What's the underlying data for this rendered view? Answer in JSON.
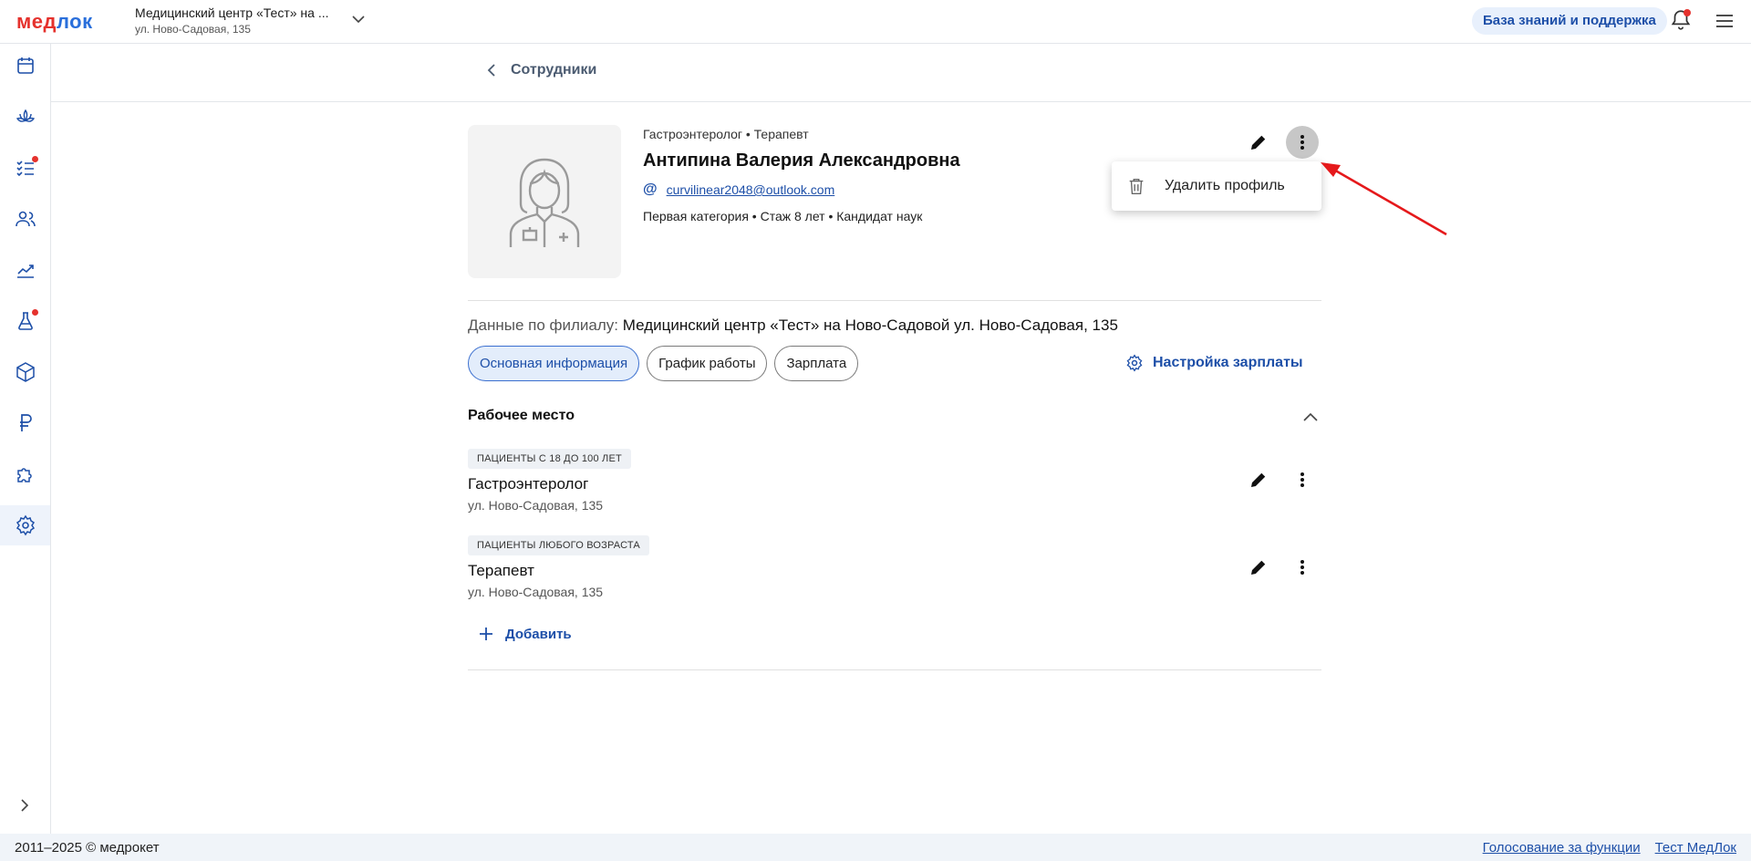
{
  "header": {
    "logo_part1": "мед",
    "logo_part2": "лок",
    "clinic_name": "Медицинский центр «Тест» на ...",
    "clinic_address": "ул. Ново-Садовая, 135",
    "kb_button": "База знаний и поддержка"
  },
  "sidebar": {
    "items": [
      {
        "icon": "calendar-icon"
      },
      {
        "icon": "lotus-icon"
      },
      {
        "icon": "checklist-icon"
      },
      {
        "icon": "users-icon"
      },
      {
        "icon": "chart-icon"
      },
      {
        "icon": "flask-icon"
      },
      {
        "icon": "box-icon"
      },
      {
        "icon": "ruble-icon"
      },
      {
        "icon": "puzzle-icon"
      },
      {
        "icon": "gear-icon"
      }
    ]
  },
  "breadcrumb": {
    "back_label": "Сотрудники"
  },
  "profile": {
    "specialties": "Гастроэнтеролог • Терапевт",
    "full_name": "Антипина Валерия Александровна",
    "email": "curvilinear2048@outlook.com",
    "meta": "Первая категория • Стаж 8 лет • Кандидат наук"
  },
  "context_menu": {
    "delete_label": "Удалить профиль"
  },
  "branch": {
    "label": "Данные по филиалу:",
    "value": "Медицинский центр «Тест» на Ново-Садовой ул. Ново-Садовая, 135"
  },
  "tabs": [
    {
      "label": "Основная информация",
      "active": true
    },
    {
      "label": "График работы",
      "active": false
    },
    {
      "label": "Зарплата",
      "active": false
    }
  ],
  "salary_settings_label": "Настройка зарплаты",
  "workplace": {
    "title": "Рабочее место",
    "items": [
      {
        "tag": "ПАЦИЕНТЫ С 18 ДО 100 ЛЕТ",
        "name": "Гастроэнтеролог",
        "address": "ул. Ново-Садовая, 135"
      },
      {
        "tag": "ПАЦИЕНТЫ ЛЮБОГО ВОЗРАСТА",
        "name": "Терапевт",
        "address": "ул. Ново-Садовая, 135"
      }
    ],
    "add_label": "Добавить"
  },
  "footer": {
    "copyright": "2011–2025 © медрокет",
    "link_vote": "Голосование за функции",
    "link_test": "Тест МедЛок"
  },
  "colors": {
    "accent": "#1d4fa8",
    "brand_red": "#e5322d",
    "active_chip_bg": "#e3edfb"
  }
}
